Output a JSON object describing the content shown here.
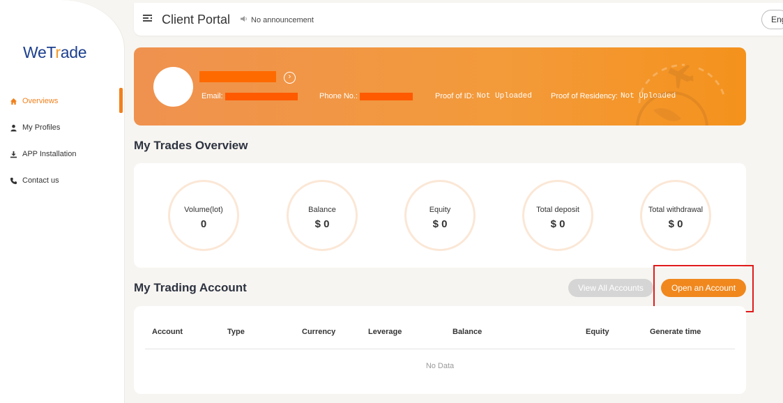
{
  "sidebar": {
    "logo_main": "WeT",
    "logo_accent": "r",
    "logo_end": "ade",
    "items": [
      {
        "label": "Overviews",
        "icon": "home-icon"
      },
      {
        "label": "My Profiles",
        "icon": "user-icon"
      },
      {
        "label": "APP Installation",
        "icon": "download-icon"
      },
      {
        "label": "Contact us",
        "icon": "phone-icon"
      }
    ]
  },
  "header": {
    "title": "Client Portal",
    "announcement": "No announcement",
    "language": "Eng"
  },
  "profile": {
    "email_label": "Email:",
    "phone_label": "Phone No.:",
    "poi_label": "Proof of ID:",
    "poi_value": "Not Uploaded",
    "por_label": "Proof of Residency:",
    "por_value": "Not Uploaded"
  },
  "overview": {
    "title": "My Trades Overview",
    "stats": [
      {
        "label": "Volume(lot)",
        "value": "0"
      },
      {
        "label": "Balance",
        "value": "$ 0"
      },
      {
        "label": "Equity",
        "value": "$ 0"
      },
      {
        "label": "Total deposit",
        "value": "$ 0"
      },
      {
        "label": "Total withdrawal",
        "value": "$ 0"
      }
    ]
  },
  "trading": {
    "title": "My Trading Account",
    "view_all": "View All Accounts",
    "open_account": "Open an Account",
    "columns": [
      "Account",
      "Type",
      "Currency",
      "Leverage",
      "Balance",
      "Equity",
      "Generate time"
    ],
    "empty_text": "No Data"
  },
  "colors": {
    "accent": "#f0811d",
    "brand_blue": "#1c3f8f",
    "highlight": "#e01b1b"
  }
}
